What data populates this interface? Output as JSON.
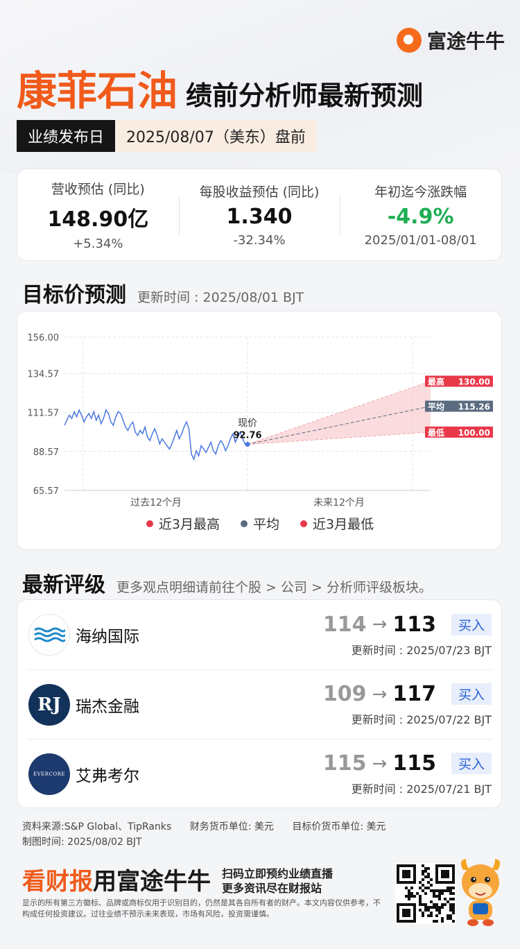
{
  "brand": {
    "name": "富途牛牛"
  },
  "header": {
    "company": "康菲石油",
    "subtitle": "绩前分析师最新预测",
    "date_label": "业绩发布日",
    "date_value": "2025/08/07（美东）盘前"
  },
  "metrics": [
    {
      "label": "营收预估 (同比)",
      "value": "148.90亿",
      "sub": "+5.34%"
    },
    {
      "label": "每股收益预估 (同比)",
      "value": "1.340",
      "sub": "-32.34%"
    },
    {
      "label": "年初迄今涨跌幅",
      "value": "-4.9%",
      "sub": "2025/01/01-08/01"
    }
  ],
  "target_section": {
    "title": "目标价预测",
    "update": "更新时间 : 2025/08/01 BJT"
  },
  "chart_data": {
    "type": "line",
    "y_ticks": [
      "156.00",
      "134.57",
      "111.57",
      "88.57",
      "65.57"
    ],
    "ylim": [
      65.57,
      156.0
    ],
    "x_labels": [
      "过去12个月",
      "未来12个月"
    ],
    "history": [
      104,
      107,
      110,
      108,
      112,
      109,
      113,
      110,
      106,
      109,
      111,
      108,
      112,
      107,
      110,
      105,
      108,
      113,
      111,
      106,
      104,
      109,
      112,
      111,
      107,
      103,
      101,
      104,
      106,
      100,
      98,
      101,
      99,
      103,
      97,
      95,
      99,
      102,
      98,
      93,
      96,
      94,
      92,
      90,
      93,
      97,
      101,
      96,
      99,
      103,
      106,
      102,
      87,
      84,
      89,
      86,
      92,
      90,
      88,
      91,
      94,
      89,
      87,
      92,
      95,
      93,
      89,
      92,
      96,
      99,
      94,
      97,
      100,
      96,
      93,
      92.76
    ],
    "current": {
      "label": "现价",
      "value": "92.76"
    },
    "high": {
      "label": "最高",
      "value": "130.00"
    },
    "avg": {
      "label": "平均",
      "value": "115.26"
    },
    "low": {
      "label": "最低",
      "value": "100.00"
    },
    "legend": [
      {
        "label": "近3月最高",
        "color": "#e8394a"
      },
      {
        "label": "平均",
        "color": "#5b6b80"
      },
      {
        "label": "近3月最低",
        "color": "#e8394a"
      }
    ],
    "colors": {
      "line": "#4a78e0",
      "band": "#f7c5c8",
      "label_red": "#e8394a",
      "label_avg": "#5b6b80"
    }
  },
  "ratings_section": {
    "title": "最新评级",
    "note": "更多观点明细请前往个股 > 公司 > 分析师评级板块。"
  },
  "ratings": [
    {
      "firm": "海纳国际",
      "old": "114",
      "new": "113",
      "rating": "买入",
      "date": "更新时间 : 2025/07/23 BJT"
    },
    {
      "firm": "瑞杰金融",
      "logo_text": "RJ",
      "old": "109",
      "new": "117",
      "rating": "买入",
      "date": "更新时间 : 2025/07/22 BJT"
    },
    {
      "firm": "艾弗考尔",
      "logo_text": "EVERCORE",
      "old": "115",
      "new": "115",
      "rating": "买入",
      "date": "更新时间 : 2025/07/21 BJT"
    }
  ],
  "footer": {
    "source": "资料来源:S&P Global、TipRanks",
    "fin_unit": "财务货币单位: 美元",
    "target_unit": "目标价货币单位: 美元",
    "made": "制图时间: 2025/08/02 BJT",
    "promo_orange": "看财报",
    "promo_black": "用富途牛牛",
    "promo_line1": "扫码立即预约业绩直播",
    "promo_line2": "更多资讯尽在财报站",
    "disclaimer": "显示的所有第三方徽标、品牌或商标仅用于识别目的，仍然是其各自所有者的财产。本文内容仅供参考，不构成任何投资建议。过往业绩不预示未来表现，市场有风险，投资需谨慎。"
  }
}
